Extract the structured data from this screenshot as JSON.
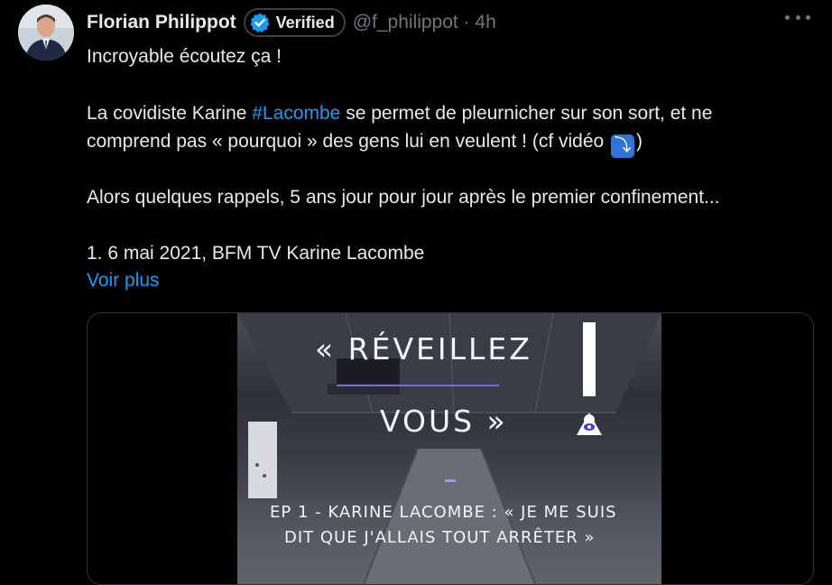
{
  "author": {
    "name": "Florian Philippot",
    "verified_label": "Verified",
    "handle": "@f_philippot · 4h"
  },
  "tweet": {
    "line1": "Incroyable écoutez ça !",
    "line2_a": "La covidiste Karine ",
    "line2_hashtag": "#Lacombe",
    "line2_b": " se permet de pleurnicher sur son sort, et ne",
    "line3_a": "comprend pas « pourquoi » des gens lui en veulent ! (cf vidéo ",
    "line3_arrow": "⤵",
    "line3_b": ")",
    "line4": "Alors quelques rappels, 5 ans jour pour jour après le premier confinement...",
    "line5": "1. 6 mai 2021, BFM TV Karine Lacombe",
    "show_more": "Voir plus"
  },
  "media": {
    "title_line1": "« RÉVEILLEZ",
    "title_line2": "VOUS »",
    "subtitle_line1": "EP 1 - KARINE LACOMBE : « JE ME SUIS",
    "subtitle_line2": "DIT QUE J'ALLAIS TOUT ARRÊTER »"
  },
  "colors": {
    "background": "#000000",
    "text": "#e7e9ea",
    "secondary": "#71767b",
    "link": "#1d9bf0",
    "verified": "#1d9bf0",
    "video_accent": "#7d63e8"
  }
}
